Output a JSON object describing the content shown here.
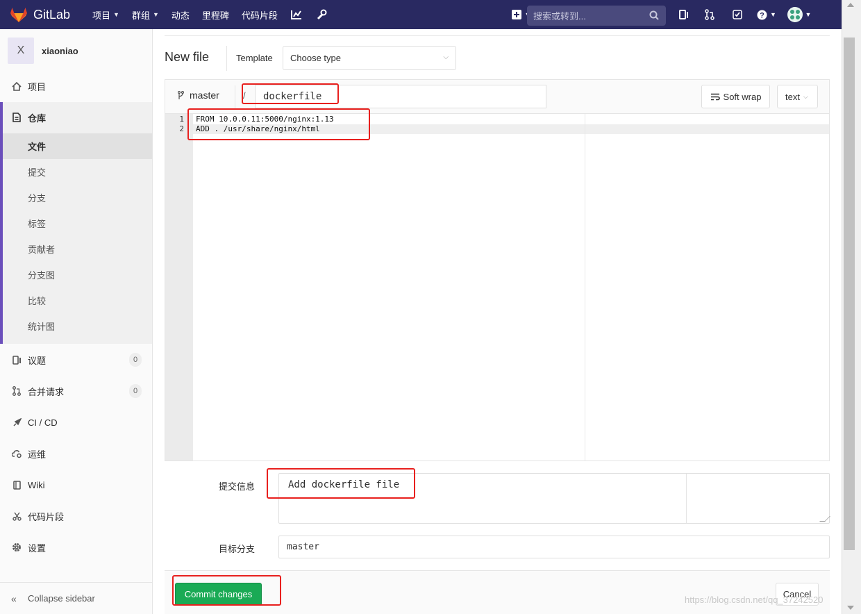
{
  "topbar": {
    "brand": "GitLab",
    "nav": [
      {
        "label": "项目",
        "dropdown": true
      },
      {
        "label": "群组",
        "dropdown": true
      },
      {
        "label": "动态",
        "dropdown": false
      },
      {
        "label": "里程碑",
        "dropdown": false
      },
      {
        "label": "代码片段",
        "dropdown": false
      }
    ],
    "search_placeholder": "搜索或转到...",
    "icons": [
      "chart-icon",
      "wrench-icon",
      "plus-square-icon",
      "issues-icon",
      "merge-request-icon",
      "todo-check-icon",
      "help-icon",
      "user-avatar-icon"
    ]
  },
  "sidebar": {
    "project_initial": "X",
    "project_name": "xiaoniao",
    "items": {
      "project": "项目",
      "repository": "仓库",
      "issues": "议题",
      "issues_count": "0",
      "merge_requests": "合并请求",
      "merge_requests_count": "0",
      "cicd": "CI / CD",
      "ops": "运维",
      "wiki": "Wiki",
      "snippets": "代码片段",
      "settings": "设置"
    },
    "repo_sub": [
      "文件",
      "提交",
      "分支",
      "标签",
      "贡献者",
      "分支图",
      "比较",
      "统计图"
    ],
    "collapse": "Collapse sidebar"
  },
  "main": {
    "title": "New file",
    "template_label": "Template",
    "template_value": "Choose type",
    "branch": "master",
    "slash": "/",
    "filename": "dockerfile",
    "soft_wrap": "Soft wrap",
    "mode": "text",
    "code_lines": [
      {
        "num": "1",
        "text": "FROM 10.0.0.11:5000/nginx:1.13"
      },
      {
        "num": "2",
        "text": "ADD . /usr/share/nginx/html"
      }
    ],
    "commit_label": "提交信息",
    "commit_message": "Add dockerfile file",
    "target_branch_label": "目标分支",
    "target_branch": "master",
    "commit_button": "Commit changes",
    "cancel_button": "Cancel"
  },
  "watermark": "https://blog.csdn.net/qq_37242520",
  "colors": {
    "topbar": "#292961",
    "accent": "#6b4fbb",
    "commit_green": "#1aaa55",
    "annotation_red": "#e8201e"
  }
}
